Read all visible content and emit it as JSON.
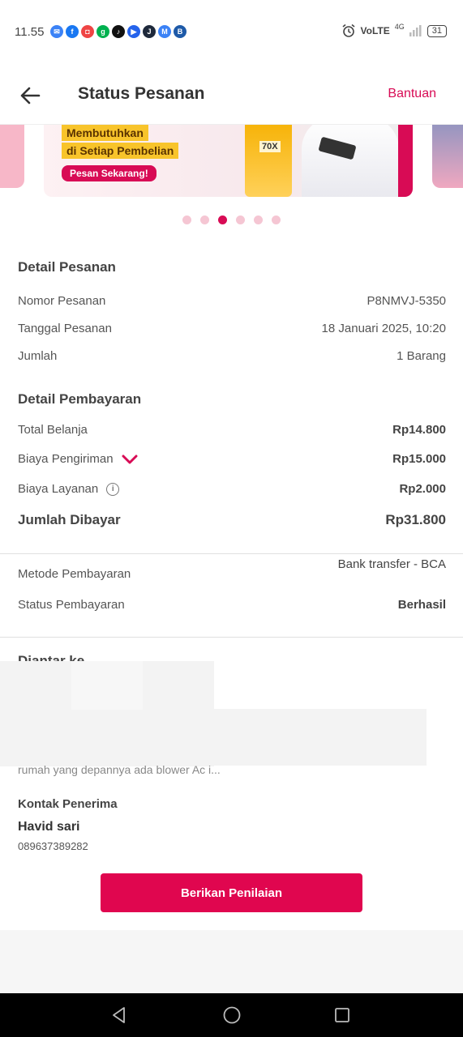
{
  "status_bar": {
    "time": "11.55",
    "network": "VoLTE",
    "network_gen": "4G",
    "battery": "31",
    "app_icons": [
      {
        "name": "messages-icon",
        "color": "#3b82f6",
        "glyph": "✉"
      },
      {
        "name": "facebook-icon",
        "color": "#1877f2",
        "glyph": "f"
      },
      {
        "name": "shopping-bag-icon",
        "color": "#ef4444",
        "glyph": "◘"
      },
      {
        "name": "grab-icon",
        "color": "#00b14f",
        "glyph": "g"
      },
      {
        "name": "tiktok-icon",
        "color": "#111111",
        "glyph": "♪"
      },
      {
        "name": "video-icon",
        "color": "#2563eb",
        "glyph": "▶"
      },
      {
        "name": "j-app-icon",
        "color": "#1e293b",
        "glyph": "J"
      },
      {
        "name": "mail-icon",
        "color": "#3b82f6",
        "glyph": "M"
      },
      {
        "name": "bca-icon",
        "color": "#1e5aa8",
        "glyph": "B"
      }
    ]
  },
  "header": {
    "title": "Status Pesanan",
    "help_label": "Bantuan"
  },
  "banner": {
    "line1": "Membutuhkan",
    "line2": "di Setiap Pembelian",
    "cta": "Pesan Sekarang!",
    "product_label": "70X",
    "slide_count": 6,
    "active_slide": 3
  },
  "order_detail": {
    "title": "Detail Pesanan",
    "rows": [
      {
        "label": "Nomor Pesanan",
        "value": "P8NMVJ-5350"
      },
      {
        "label": "Tanggal Pesanan",
        "value": "18 Januari 2025, 10:20"
      },
      {
        "label": "Jumlah",
        "value": "1 Barang"
      }
    ]
  },
  "payment_detail": {
    "title": "Detail Pembayaran",
    "total_belanja_label": "Total Belanja",
    "total_belanja_value": "Rp14.800",
    "pengiriman_label": "Biaya Pengiriman",
    "pengiriman_value": "Rp15.000",
    "layanan_label": "Biaya Layanan",
    "layanan_value": "Rp2.000",
    "jumlah_label": "Jumlah Dibayar",
    "jumlah_value": "Rp31.800"
  },
  "payment_method": {
    "method_label": "Metode Pembayaran",
    "method_value": "Bank transfer - BCA",
    "status_label": "Status Pembayaran",
    "status_value": "Berhasil"
  },
  "delivery": {
    "title": "Diantar ke",
    "address_note": "rumah yang depannya ada blower Ac i...",
    "contact_title": "Kontak Penerima",
    "contact_name": "Havid sari",
    "contact_phone": "089637389282"
  },
  "actions": {
    "rate_label": "Berikan Penilaian"
  },
  "colors": {
    "accent": "#d80b55",
    "button": "#e0064f"
  }
}
